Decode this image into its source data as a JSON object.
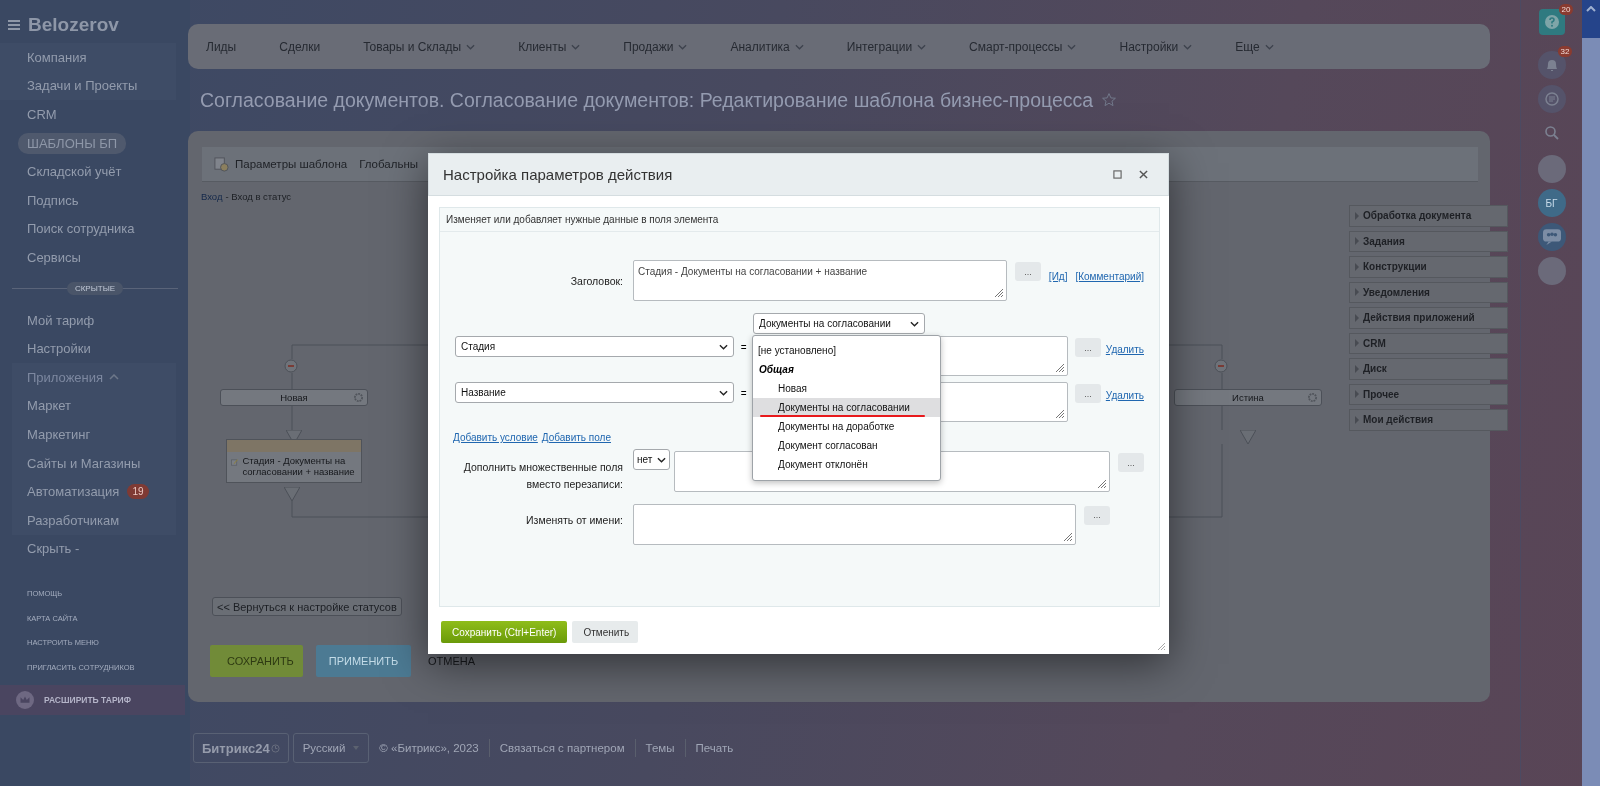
{
  "sidebar": {
    "logo": "Belozerov",
    "items": [
      {
        "label": "Компания",
        "selected": false
      },
      {
        "label": "Задачи и Проекты",
        "selected": false
      },
      {
        "label": "CRM",
        "selected": false
      },
      {
        "label": "ШАБЛОНЫ БП",
        "selected": true
      },
      {
        "label": "Складской учёт",
        "selected": false
      },
      {
        "label": "Подпись",
        "selected": false
      },
      {
        "label": "Поиск сотрудника",
        "selected": false
      },
      {
        "label": "Сервисы",
        "selected": false
      }
    ],
    "hidden": {
      "label": "СКРЫТЫЕ",
      "items": [
        {
          "label": "Мой тариф"
        },
        {
          "label": "Настройки"
        },
        {
          "label": "Приложения",
          "expanded": true,
          "children": [
            {
              "label": "Маркет"
            },
            {
              "label": "Маркетинг"
            },
            {
              "label": "Сайты и Магазины"
            },
            {
              "label": "Автоматизация",
              "badge": "19"
            },
            {
              "label": "Разработчикам"
            }
          ]
        },
        {
          "label": "Скрыть -"
        }
      ]
    },
    "links": [
      "ПОМОЩЬ",
      "КАРТА САЙТА",
      "НАСТРОИТЬ МЕНЮ",
      "ПРИГЛАСИТЬ СОТРУДНИКОВ"
    ],
    "upgrade": "РАСШИРИТЬ ТАРИФ"
  },
  "nav": [
    {
      "label": "Лиды",
      "menu": false
    },
    {
      "label": "Сделки",
      "menu": false
    },
    {
      "label": "Товары и Склады",
      "menu": true
    },
    {
      "label": "Клиенты",
      "menu": true
    },
    {
      "label": "Продажи",
      "menu": true
    },
    {
      "label": "Аналитика",
      "menu": true
    },
    {
      "label": "Интеграции",
      "menu": true
    },
    {
      "label": "Смарт-процессы",
      "menu": true
    },
    {
      "label": "Настройки",
      "menu": true
    },
    {
      "label": "Еще",
      "menu": true
    }
  ],
  "page_title": "Согласование документов. Согласование документов: Редактирование шаблона бизнес-процесса",
  "editor": {
    "tabs": [
      "Параметры шаблона",
      "Глобальны"
    ],
    "breadcrumb": {
      "link": "Вход",
      "text": "- Вход в статус"
    },
    "diagram": {
      "nodes": [
        "Новая",
        "Истина"
      ],
      "action": "Стадия - Документы на согласовании + название"
    },
    "back_button": "<< Вернуться к настройке статусов",
    "buttons": [
      {
        "label": "СОХРАНИТЬ",
        "kind": "save"
      },
      {
        "label": "ПРИМЕНИТЬ",
        "kind": "apply"
      },
      {
        "label": "ОТМЕНА",
        "kind": "link"
      }
    ],
    "palette": [
      "Обработка документа",
      "Задания",
      "Конструкции",
      "Уведомления",
      "Действия приложений",
      "CRM",
      "Диск",
      "Прочее",
      "Мои действия"
    ]
  },
  "modal": {
    "title": "Настройка параметров действия",
    "description": "Изменяет или добавляет нужные данные в поля элемента",
    "title_field": {
      "label": "Заголовок:",
      "value": "Стадия - Документы на согласовании + название",
      "button": "...",
      "links": [
        "[Ид]",
        "[Комментарий]"
      ]
    },
    "conditions": [
      {
        "field": "Стадия",
        "operator": "=",
        "button": "...",
        "remove": "Удалить",
        "value_select": {
          "value": "Документы на согласовании",
          "open": true,
          "options": [
            {
              "kind": "option",
              "label": "[не установлено]",
              "selected": false
            },
            {
              "kind": "group",
              "label": "Общая",
              "children": [
                {
                  "label": "Новая",
                  "selected": false,
                  "underlined": false
                },
                {
                  "label": "Документы на согласовании",
                  "selected": true,
                  "underlined": true
                },
                {
                  "label": "Документы на доработке",
                  "selected": false,
                  "underlined": false
                },
                {
                  "label": "Документ согласован",
                  "selected": false,
                  "underlined": false
                },
                {
                  "label": "Документ отклонён",
                  "selected": false,
                  "underlined": false
                }
              ]
            }
          ]
        }
      },
      {
        "field": "Название",
        "operator": "=",
        "button": "...",
        "remove": "Удалить"
      }
    ],
    "add_links": [
      "Добавить условие",
      "Добавить поле"
    ],
    "rows": [
      {
        "label": "Дополнить множественные поля вместо перезаписи:",
        "select": "нет",
        "button": "..."
      },
      {
        "label": "Изменять от имени:",
        "button": "..."
      }
    ],
    "buttons": [
      {
        "label": "Сохранить (Ctrl+Enter)",
        "kind": "primary"
      },
      {
        "label": "Отменить",
        "kind": "secondary"
      }
    ]
  },
  "right_rail": {
    "help_badge": "20",
    "bell_badge": "32",
    "initials": "БГ"
  },
  "footer": {
    "logo": "Битрикс24",
    "language": "Русский",
    "copyright": "© «Битрикс», 2023",
    "links": [
      "Связаться с партнером",
      "Темы",
      "Печать"
    ]
  }
}
